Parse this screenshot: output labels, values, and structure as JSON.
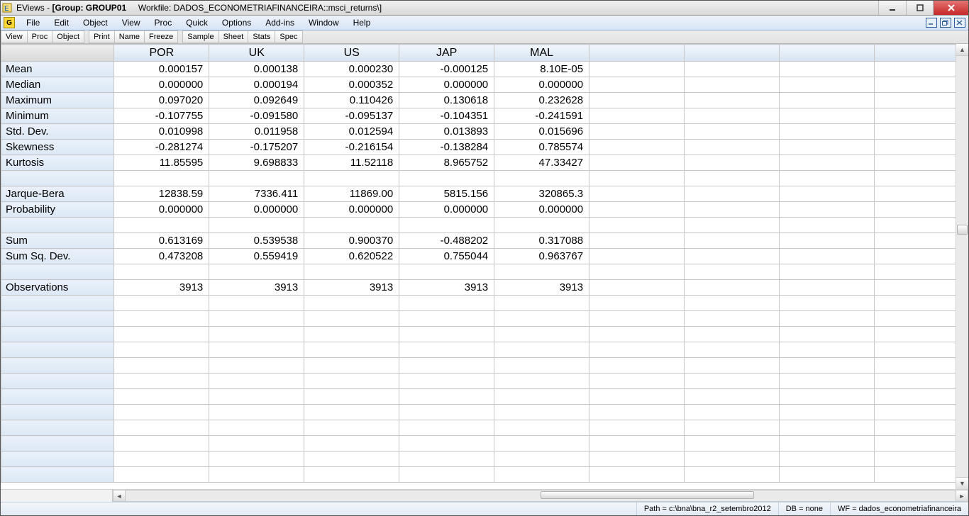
{
  "window": {
    "app_name": "EViews",
    "title_group": "[Group: GROUP01",
    "title_workfile": "Workfile: DADOS_ECONOMETRIAFINANCEIRA::msci_returns\\]"
  },
  "menubar": {
    "items": [
      "File",
      "Edit",
      "Object",
      "View",
      "Proc",
      "Quick",
      "Options",
      "Add-ins",
      "Window",
      "Help"
    ]
  },
  "toolbar": {
    "group1": [
      "View",
      "Proc",
      "Object"
    ],
    "group2": [
      "Print",
      "Name",
      "Freeze"
    ],
    "group3": [
      "Sample",
      "Sheet",
      "Stats",
      "Spec"
    ]
  },
  "grid": {
    "columns": [
      "POR",
      "UK",
      "US",
      "JAP",
      "MAL"
    ],
    "rows": [
      {
        "label": "Mean",
        "values": [
          "0.000157",
          "0.000138",
          "0.000230",
          "-0.000125",
          "8.10E-05"
        ]
      },
      {
        "label": "Median",
        "values": [
          "0.000000",
          "0.000194",
          "0.000352",
          "0.000000",
          "0.000000"
        ]
      },
      {
        "label": "Maximum",
        "values": [
          "0.097020",
          "0.092649",
          "0.110426",
          "0.130618",
          "0.232628"
        ]
      },
      {
        "label": "Minimum",
        "values": [
          "-0.107755",
          "-0.091580",
          "-0.095137",
          "-0.104351",
          "-0.241591"
        ]
      },
      {
        "label": "Std. Dev.",
        "values": [
          "0.010998",
          "0.011958",
          "0.012594",
          "0.013893",
          "0.015696"
        ]
      },
      {
        "label": "Skewness",
        "values": [
          "-0.281274",
          "-0.175207",
          "-0.216154",
          "-0.138284",
          "0.785574"
        ]
      },
      {
        "label": "Kurtosis",
        "values": [
          "11.85595",
          "9.698833",
          "11.52118",
          "8.965752",
          "47.33427"
        ]
      },
      {
        "label": "",
        "values": [
          "",
          "",
          "",
          "",
          ""
        ]
      },
      {
        "label": "Jarque-Bera",
        "values": [
          "12838.59",
          "7336.411",
          "11869.00",
          "5815.156",
          "320865.3"
        ]
      },
      {
        "label": "Probability",
        "values": [
          "0.000000",
          "0.000000",
          "0.000000",
          "0.000000",
          "0.000000"
        ]
      },
      {
        "label": "",
        "values": [
          "",
          "",
          "",
          "",
          ""
        ]
      },
      {
        "label": "Sum",
        "values": [
          "0.613169",
          "0.539538",
          "0.900370",
          "-0.488202",
          "0.317088"
        ]
      },
      {
        "label": "Sum Sq. Dev.",
        "values": [
          "0.473208",
          "0.559419",
          "0.620522",
          "0.755044",
          "0.963767"
        ]
      },
      {
        "label": "",
        "values": [
          "",
          "",
          "",
          "",
          ""
        ]
      },
      {
        "label": "Observations",
        "values": [
          "3913",
          "3913",
          "3913",
          "3913",
          "3913"
        ]
      }
    ],
    "extra_blank_rows": 12,
    "extra_blank_cols": 4
  },
  "statusbar": {
    "path": "Path = c:\\bna\\bna_r2_setembro2012",
    "db": "DB = none",
    "wf": "WF = dados_econometriafinanceira"
  }
}
